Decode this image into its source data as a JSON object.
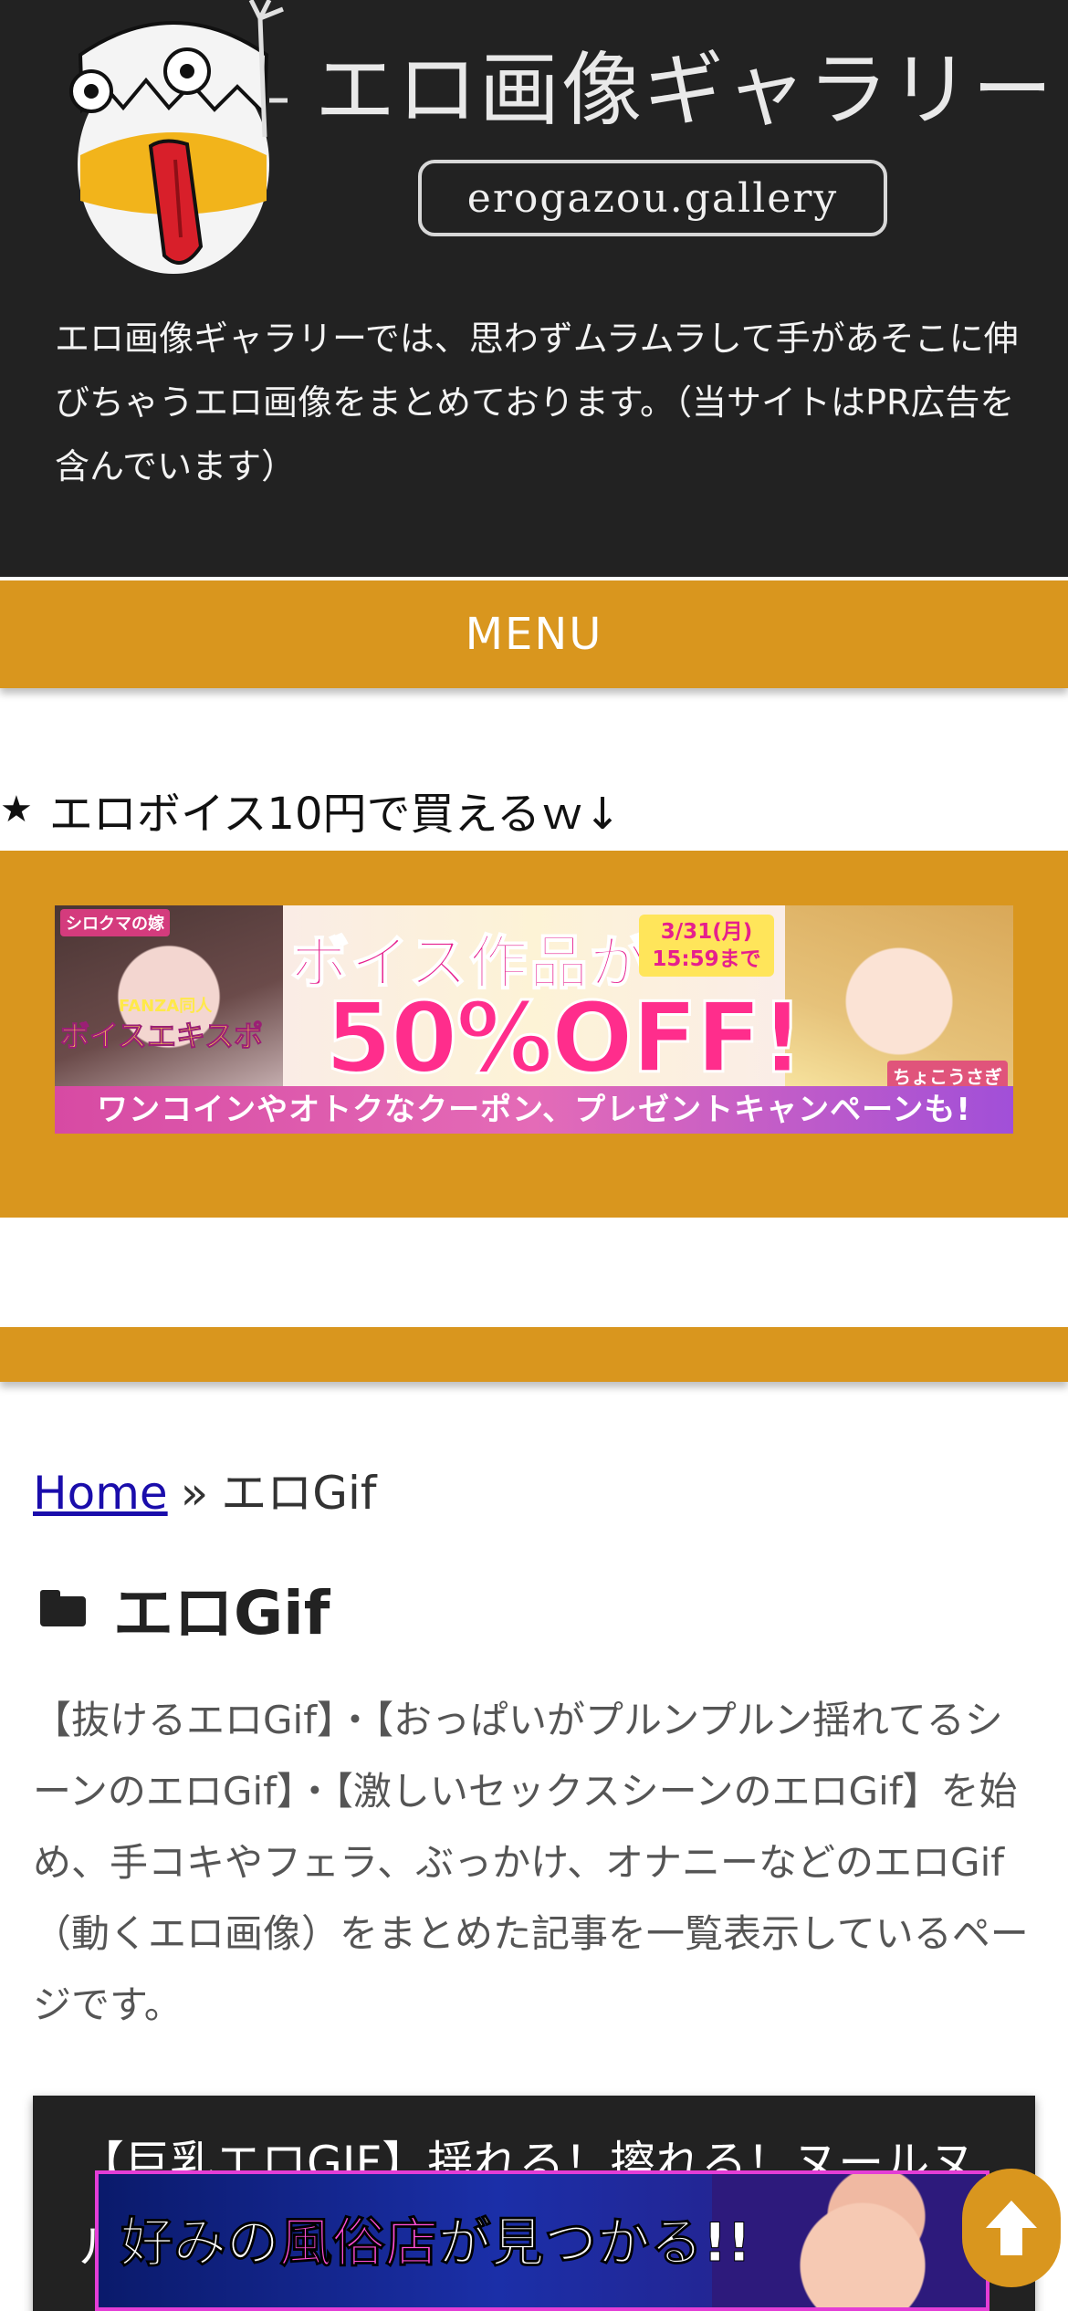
{
  "header": {
    "site_title": "エロ画像ギャラリー",
    "domain_label": "erogazou.gallery",
    "description": "エロ画像ギャラリーでは、思わずムラムラして手があそこに伸びちゃうエロ画像をまとめております。（当サイトはPR広告を含んでいます）"
  },
  "menu": {
    "label": "MENU"
  },
  "widget": {
    "title": "エロボイス10円で買えるｗ↓",
    "icon": "star-icon"
  },
  "ad_banner": {
    "tag_left": "シロクマの嫁",
    "tag_fanza": "FANZA同人",
    "tag_expo": "ボイスエキスポ",
    "headline": "ボイス作品が",
    "date_line1": "3/31(月)",
    "date_line2": "15:59まで",
    "discount": "50%OFF!",
    "subline": "ワンコインやオトクなクーポン、プレゼントキャンペーンも!",
    "tag_right": "ちょこうさぎ"
  },
  "breadcrumb": {
    "home": "Home",
    "separator": "»",
    "current": "エロGif"
  },
  "category": {
    "title": "エロGif",
    "description": "【抜けるエロGif】・【おっぱいがプルンプルン揺れてるシーンのエロGif】・【激しいセックスシーンのエロGif】を始め、手コキやフェラ、ぶっかけ、オナニーなどのエロGif（動くエロ画像）をまとめた記事を一覧表示しているページです。"
  },
  "article": {
    "title": "【巨乳エロGIF】揺れる！擦れる！ヌールヌル"
  },
  "bottom_ad": {
    "text_before": "好みの",
    "text_highlight": "風俗店",
    "text_after": "が見つかる!!"
  },
  "colors": {
    "header_bg": "#222222",
    "accent": "#d9961e",
    "link": "#1a0dab"
  }
}
